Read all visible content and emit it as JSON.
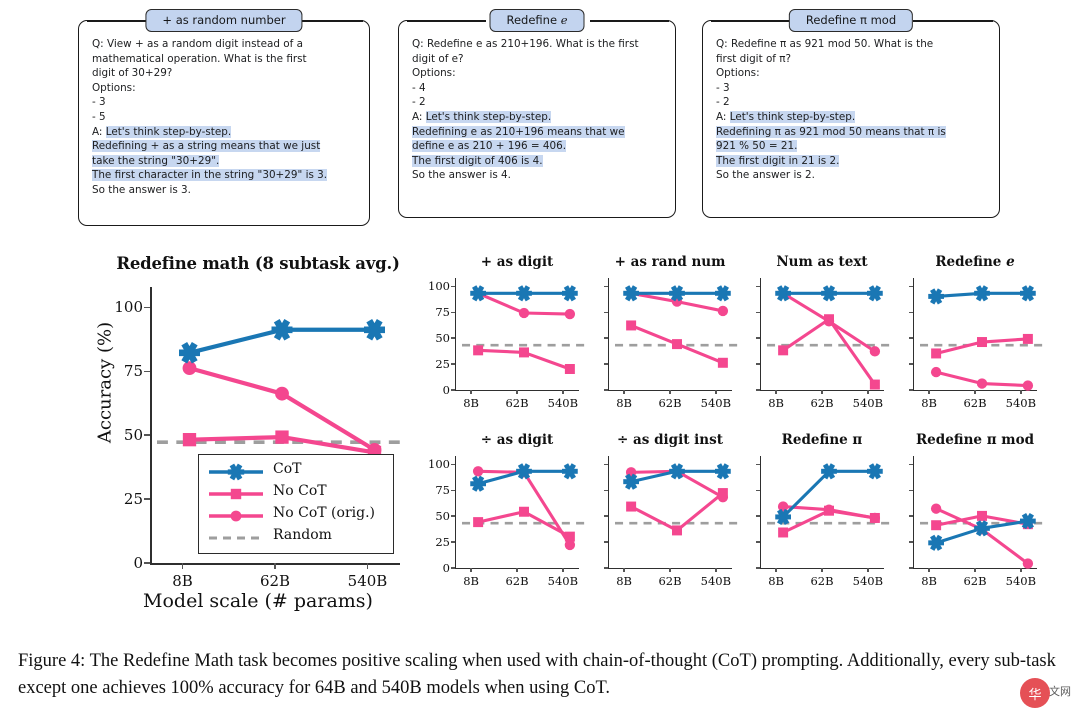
{
  "examples": [
    {
      "title": "+ as random number",
      "lines": [
        {
          "t": "Q: View + as a random digit instead of a",
          "h": false
        },
        {
          "t": "mathematical operation. What is the first",
          "h": false
        },
        {
          "t": "digit of 30+29?",
          "h": false
        },
        {
          "t": "Options:",
          "h": false
        },
        {
          "t": "- 3",
          "h": false
        },
        {
          "t": "- 5",
          "h": false
        },
        {
          "t": "A: ",
          "h": false,
          "hl": "Let's think step-by-step."
        },
        {
          "t": "",
          "h": true,
          "hl": "Redefining + as a string means that we just"
        },
        {
          "t": "",
          "h": true,
          "hl": "take the string \"30+29\"."
        },
        {
          "t": "",
          "h": true,
          "hl": "The first character in the string \"30+29\" is 3."
        },
        {
          "t": "So the answer is 3.",
          "h": false
        }
      ]
    },
    {
      "title": "Redefine e",
      "title_italic_tail": "e",
      "lines": [
        {
          "t": "Q: Redefine e as 210+196. What is the first",
          "h": false
        },
        {
          "t": "digit of e?",
          "h": false
        },
        {
          "t": "Options:",
          "h": false
        },
        {
          "t": "- 4",
          "h": false
        },
        {
          "t": "- 2",
          "h": false
        },
        {
          "t": "A: ",
          "h": false,
          "hl": "Let's think step-by-step."
        },
        {
          "t": "",
          "h": true,
          "hl": "Redefining e as 210+196 means that we"
        },
        {
          "t": "",
          "h": true,
          "hl": "define e as 210 + 196 = 406."
        },
        {
          "t": "",
          "h": true,
          "hl": "The first digit of 406 is 4."
        },
        {
          "t": "So the answer is 4.",
          "h": false
        }
      ]
    },
    {
      "title": "Redefine π mod",
      "lines": [
        {
          "t": "Q: Redefine π as 921 mod 50. What is the",
          "h": false
        },
        {
          "t": "first digit of π?",
          "h": false
        },
        {
          "t": "Options:",
          "h": false
        },
        {
          "t": "- 3",
          "h": false
        },
        {
          "t": "- 2",
          "h": false
        },
        {
          "t": "A: ",
          "h": false,
          "hl": "Let's think step-by-step."
        },
        {
          "t": "",
          "h": true,
          "hl": "Redefining π as 921 mod 50 means that π is"
        },
        {
          "t": "",
          "h": true,
          "hl": "921 % 50 = 21."
        },
        {
          "t": "",
          "h": true,
          "hl": "The first digit in 21 is 2."
        },
        {
          "t": "So the answer is 2.",
          "h": false
        }
      ]
    }
  ],
  "colors": {
    "cot": "#1a77b4",
    "nocot": "#f4478f",
    "random": "#9e9e9e",
    "highlight": "#c7d7f0",
    "title_bar": "#c3d4ef"
  },
  "legend": {
    "items": [
      {
        "label": "CoT",
        "marker": "star",
        "color": "#1a77b4"
      },
      {
        "label": "No CoT",
        "marker": "square",
        "color": "#f4478f"
      },
      {
        "label": "No CoT (orig.)",
        "marker": "circle",
        "color": "#f4478f"
      },
      {
        "label": "Random",
        "marker": "dashed",
        "color": "#9e9e9e"
      }
    ]
  },
  "axes": {
    "xticks": [
      "8B",
      "62B",
      "540B"
    ],
    "yticks_main": [
      "0",
      "25",
      "50",
      "75",
      "100"
    ],
    "ylabel": "Accuracy (%)",
    "xlabel": "Model scale (# params)"
  },
  "caption": {
    "line1": "Figure 4: The Redefine Math task becomes positive scaling when used with chain-of-thought (CoT) prompting.",
    "line2": "Additionally, every sub-task except one achieves 100% accuracy for 64B and 540B models when using CoT."
  },
  "watermark": {
    "glyph": "华",
    "tail": "文网"
  },
  "chart_data": [
    {
      "type": "line",
      "title": "Redefine math (8 subtask avg.)",
      "xlabel": "Model scale (# params)",
      "ylabel": "Accuracy (%)",
      "categories": [
        "8B",
        "62B",
        "540B"
      ],
      "ylim": [
        0,
        108
      ],
      "yticks": [
        0,
        25,
        50,
        75,
        100
      ],
      "grid": false,
      "legend_position": "inside-bottom-center",
      "random_baseline": 50,
      "series": [
        {
          "name": "CoT",
          "marker": "star",
          "color": "#1a77b4",
          "values": [
            85,
            94,
            94
          ]
        },
        {
          "name": "No CoT",
          "marker": "square",
          "color": "#f4478f",
          "values": [
            51,
            52,
            46
          ]
        },
        {
          "name": "No CoT (orig.)",
          "marker": "circle",
          "color": "#f4478f",
          "values": [
            79,
            69,
            47
          ]
        }
      ]
    },
    {
      "type": "line",
      "title": "+ as digit",
      "categories": [
        "8B",
        "62B",
        "540B"
      ],
      "ylim": [
        0,
        108
      ],
      "yticks": [
        0,
        25,
        50,
        75,
        100
      ],
      "show_yticklabels": true,
      "random_baseline": 50,
      "series": [
        {
          "name": "CoT",
          "marker": "star",
          "color": "#1a77b4",
          "values": [
            100,
            100,
            100
          ]
        },
        {
          "name": "No CoT",
          "marker": "square",
          "color": "#f4478f",
          "values": [
            45,
            43,
            27
          ]
        },
        {
          "name": "No CoT (orig.)",
          "marker": "circle",
          "color": "#f4478f",
          "values": [
            100,
            81,
            80
          ]
        }
      ]
    },
    {
      "type": "line",
      "title": "+ as rand num",
      "categories": [
        "8B",
        "62B",
        "540B"
      ],
      "ylim": [
        0,
        108
      ],
      "yticks": [
        0,
        25,
        50,
        75,
        100
      ],
      "show_yticklabels": false,
      "random_baseline": 50,
      "series": [
        {
          "name": "CoT",
          "marker": "star",
          "color": "#1a77b4",
          "values": [
            100,
            100,
            100
          ]
        },
        {
          "name": "No CoT",
          "marker": "square",
          "color": "#f4478f",
          "values": [
            69,
            51,
            33
          ]
        },
        {
          "name": "No CoT (orig.)",
          "marker": "circle",
          "color": "#f4478f",
          "values": [
            100,
            92,
            83
          ]
        }
      ]
    },
    {
      "type": "line",
      "title": "Num as text",
      "categories": [
        "8B",
        "62B",
        "540B"
      ],
      "ylim": [
        0,
        108
      ],
      "yticks": [
        0,
        25,
        50,
        75,
        100
      ],
      "show_yticklabels": false,
      "random_baseline": 50,
      "series": [
        {
          "name": "CoT",
          "marker": "star",
          "color": "#1a77b4",
          "values": [
            100,
            100,
            100
          ]
        },
        {
          "name": "No CoT",
          "marker": "square",
          "color": "#f4478f",
          "values": [
            45,
            75,
            12
          ]
        },
        {
          "name": "No CoT (orig.)",
          "marker": "circle",
          "color": "#f4478f",
          "values": [
            100,
            73,
            44
          ]
        }
      ]
    },
    {
      "type": "line",
      "title": "Redefine e",
      "categories": [
        "8B",
        "62B",
        "540B"
      ],
      "ylim": [
        0,
        108
      ],
      "yticks": [
        0,
        25,
        50,
        75,
        100
      ],
      "show_yticklabels": false,
      "random_baseline": 50,
      "series": [
        {
          "name": "CoT",
          "marker": "star",
          "color": "#1a77b4",
          "values": [
            97,
            100,
            100
          ]
        },
        {
          "name": "No CoT",
          "marker": "square",
          "color": "#f4478f",
          "values": [
            42,
            53,
            56
          ]
        },
        {
          "name": "No CoT (orig.)",
          "marker": "circle",
          "color": "#f4478f",
          "values": [
            24,
            13,
            11
          ]
        }
      ]
    },
    {
      "type": "line",
      "title": "÷ as digit",
      "categories": [
        "8B",
        "62B",
        "540B"
      ],
      "ylim": [
        0,
        108
      ],
      "yticks": [
        0,
        25,
        50,
        75,
        100
      ],
      "show_yticklabels": true,
      "random_baseline": 50,
      "series": [
        {
          "name": "CoT",
          "marker": "star",
          "color": "#1a77b4",
          "values": [
            88,
            100,
            100
          ]
        },
        {
          "name": "No CoT",
          "marker": "square",
          "color": "#f4478f",
          "values": [
            51,
            61,
            37
          ]
        },
        {
          "name": "No CoT (orig.)",
          "marker": "circle",
          "color": "#f4478f",
          "values": [
            100,
            99,
            29
          ]
        }
      ]
    },
    {
      "type": "line",
      "title": "÷ as digit inst",
      "categories": [
        "8B",
        "62B",
        "540B"
      ],
      "ylim": [
        0,
        108
      ],
      "yticks": [
        0,
        25,
        50,
        75,
        100
      ],
      "show_yticklabels": false,
      "random_baseline": 50,
      "series": [
        {
          "name": "CoT",
          "marker": "star",
          "color": "#1a77b4",
          "values": [
            90,
            100,
            100
          ]
        },
        {
          "name": "No CoT",
          "marker": "square",
          "color": "#f4478f",
          "values": [
            66,
            43,
            79
          ]
        },
        {
          "name": "No CoT (orig.)",
          "marker": "circle",
          "color": "#f4478f",
          "values": [
            99,
            100,
            75
          ]
        }
      ]
    },
    {
      "type": "line",
      "title": "Redefine π",
      "categories": [
        "8B",
        "62B",
        "540B"
      ],
      "ylim": [
        0,
        108
      ],
      "yticks": [
        0,
        25,
        50,
        75,
        100
      ],
      "show_yticklabels": false,
      "random_baseline": 50,
      "series": [
        {
          "name": "CoT",
          "marker": "star",
          "color": "#1a77b4",
          "values": [
            56,
            100,
            100
          ]
        },
        {
          "name": "No CoT",
          "marker": "square",
          "color": "#f4478f",
          "values": [
            41,
            62,
            55
          ]
        },
        {
          "name": "No CoT (orig.)",
          "marker": "circle",
          "color": "#f4478f",
          "values": [
            66,
            63,
            55
          ]
        }
      ]
    },
    {
      "type": "line",
      "title": "Redefine π mod",
      "categories": [
        "8B",
        "62B",
        "540B"
      ],
      "ylim": [
        0,
        108
      ],
      "yticks": [
        0,
        25,
        50,
        75,
        100
      ],
      "show_yticklabels": false,
      "random_baseline": 50,
      "series": [
        {
          "name": "CoT",
          "marker": "star",
          "color": "#1a77b4",
          "values": [
            31,
            45,
            52
          ]
        },
        {
          "name": "No CoT",
          "marker": "square",
          "color": "#f4478f",
          "values": [
            48,
            57,
            49
          ]
        },
        {
          "name": "No CoT (orig.)",
          "marker": "circle",
          "color": "#f4478f",
          "values": [
            64,
            44,
            11
          ]
        }
      ]
    }
  ]
}
